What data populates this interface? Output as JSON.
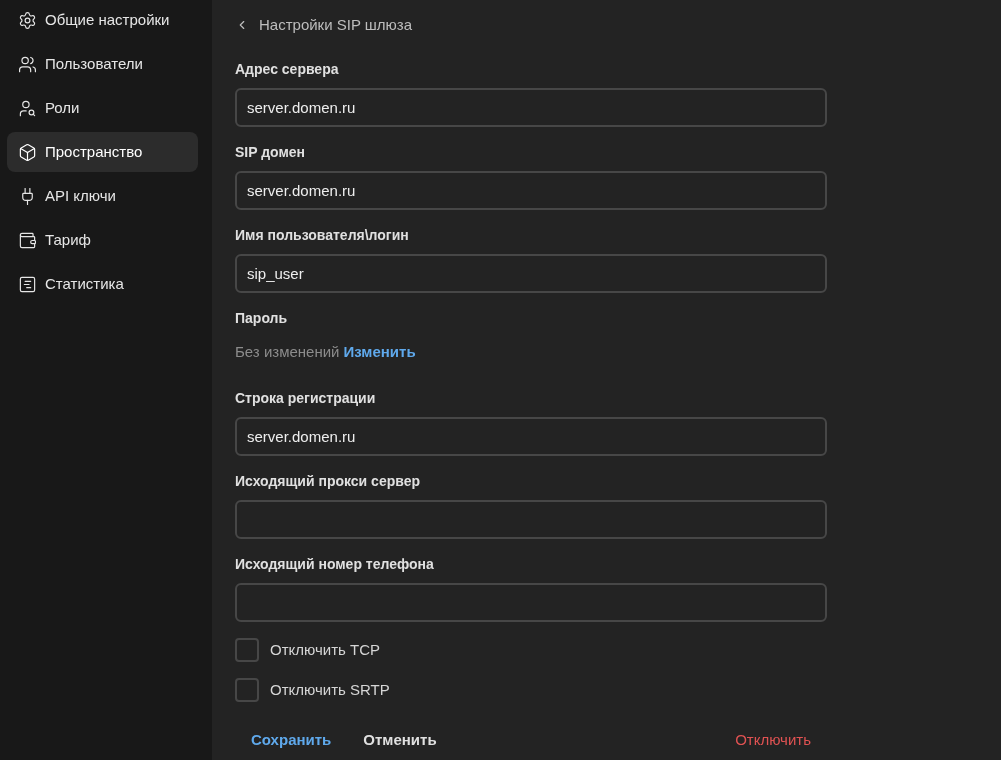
{
  "sidebar": {
    "items": [
      {
        "label": "Общие настройки",
        "selected": false
      },
      {
        "label": "Пользователи",
        "selected": false
      },
      {
        "label": "Роли",
        "selected": false
      },
      {
        "label": "Пространство",
        "selected": true
      },
      {
        "label": "API ключи",
        "selected": false
      },
      {
        "label": "Тариф",
        "selected": false
      },
      {
        "label": "Статистика",
        "selected": false
      }
    ]
  },
  "header": {
    "title": "Настройки SIP шлюза"
  },
  "fields": [
    {
      "kind": "input",
      "label": "Адрес сервера",
      "value": "server.domen.ru"
    },
    {
      "kind": "input",
      "label": "SIP домен",
      "value": "server.domen.ru"
    },
    {
      "kind": "input",
      "label": "Имя пользователя\\логин",
      "value": "sip_user"
    },
    {
      "kind": "password",
      "label": "Пароль",
      "status": "Без изменений",
      "link": "Изменить"
    },
    {
      "kind": "input",
      "label": "Строка регистрации",
      "value": "server.domen.ru"
    },
    {
      "kind": "input",
      "label": "Исходящий прокси сервер"
    },
    {
      "kind": "input",
      "label": "Исходящий номер телефона"
    }
  ],
  "checkboxes": [
    {
      "label": "Отключить TCP",
      "checked": false
    },
    {
      "label": "Отключить SRTP",
      "checked": false
    }
  ],
  "actions": {
    "save": "Сохранить",
    "cancel": "Отменить",
    "disable": "Отключить"
  }
}
